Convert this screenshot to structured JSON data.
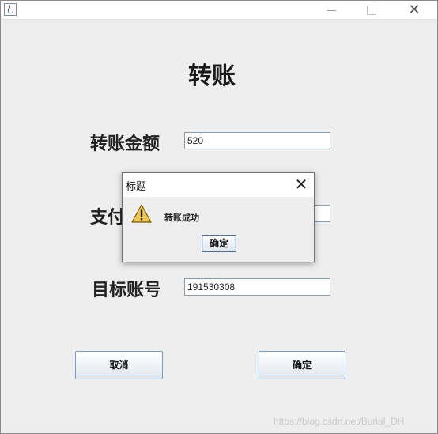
{
  "form": {
    "heading": "转账",
    "amount_label": "转账金额",
    "amount_value": "520",
    "password_label": "支付",
    "target_label": "目标账号",
    "target_value": "191530308",
    "cancel_label": "取消",
    "confirm_label": "确定"
  },
  "dialog": {
    "title": "标题",
    "message": "转账成功",
    "ok_label": "确定",
    "close_glyph": "✕",
    "icon": "warning-icon"
  },
  "window": {
    "close_glyph": "✕"
  },
  "watermark": {
    "text": "https://blog.csdn.net/Burial_DH"
  },
  "colors": {
    "window_bg": "#eeeeee",
    "button_border": "#7a9bc4",
    "warning_fill": "#f2c84b"
  }
}
